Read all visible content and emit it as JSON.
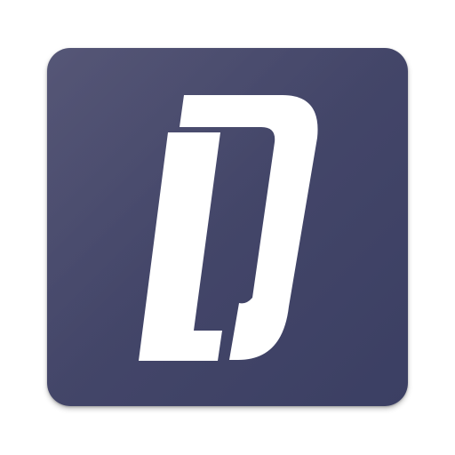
{
  "app_icon": {
    "name": "app-icon",
    "logo": "ld-monogram-logo",
    "colors": {
      "background_start": "#4b4c6e",
      "background_end": "#3b3f63",
      "glyph": "#ffffff"
    }
  }
}
